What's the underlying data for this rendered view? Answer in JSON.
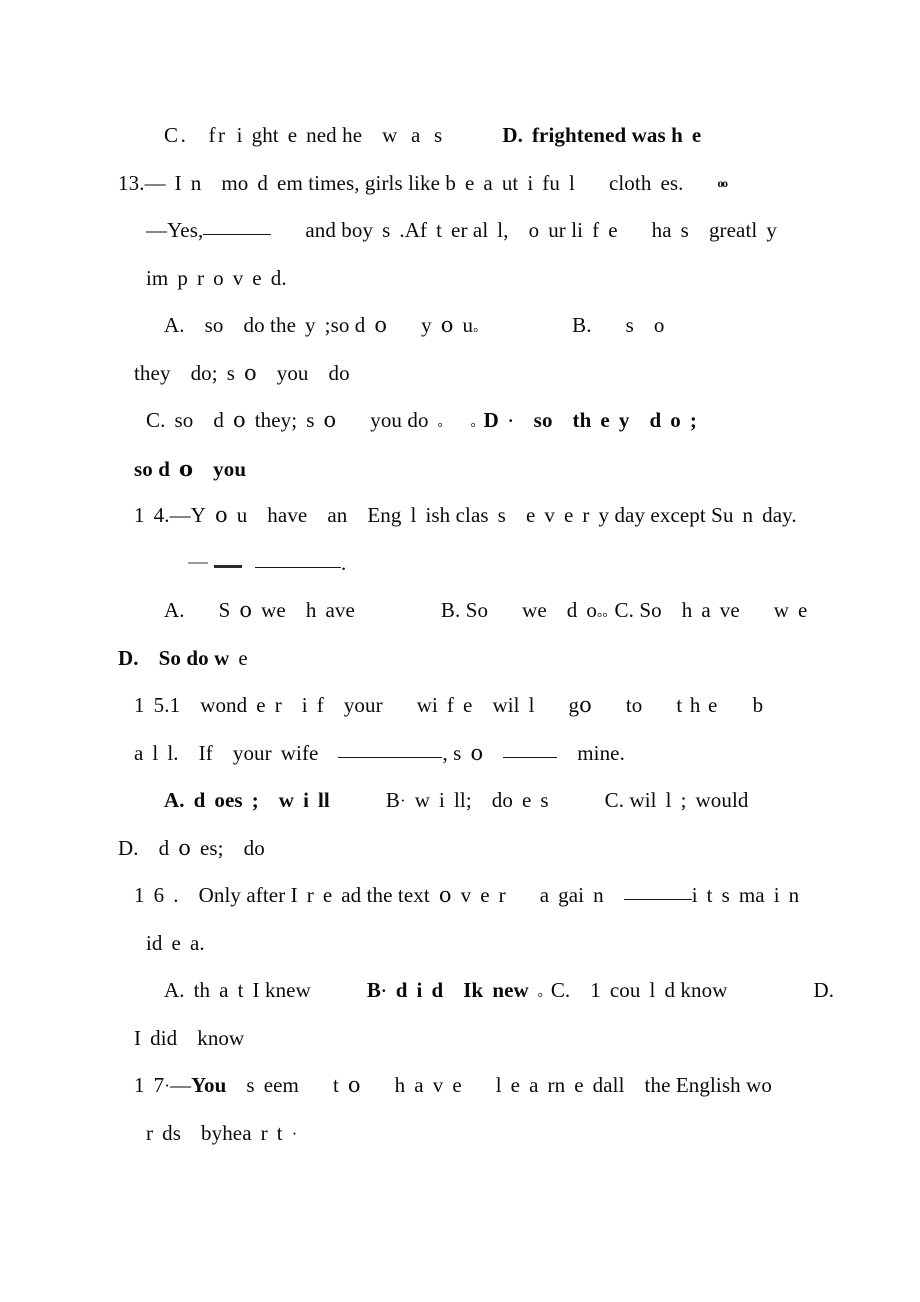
{
  "document": {
    "type": "scanned-exam-worksheet",
    "language": "English grammar multiple-choice",
    "page_background": "#ffffff",
    "text_color": "#0a0a0a"
  },
  "lines": {
    "l01_c_option": {
      "letter": "C.",
      "text_a": "fr",
      "text_b": "i",
      "text_c": "ght",
      "text_d": "e",
      "text_e": "ned he",
      "text_f": "w a s",
      "d_letter": "D",
      "d_sep": ".",
      "d_text": "frightened was h",
      "d_tail": "e"
    },
    "q13": {
      "number": "13.",
      "dash": "—",
      "t1": "I",
      "t2": "n",
      "t3": "mo",
      "t4": "d",
      "t5": "em times, girls like b",
      "t6": "e",
      "t7": "a",
      "t8": "ut",
      "t9": "i",
      "t10": "fu",
      "t11": "l",
      "t12": "cloth",
      "t13": "e",
      "t14": "s.",
      "artifact": "oo"
    },
    "q13_answer": {
      "dash": "—",
      "yes": "Yes,",
      "and_boy": "and boy",
      "s": "s",
      "period": ".",
      "after": "Af",
      "t": "t",
      "er_al": "er al",
      "l": "l",
      "comma": ",",
      "o": "o",
      "ur_li": "ur li",
      "f": "f",
      "e": "e",
      "has": "ha",
      "s2": "s",
      "greatl": "greatl",
      "y": "y"
    },
    "q13_answer2": {
      "im": "im",
      "p": "p",
      "r": "r",
      "o": "o",
      "v": "v",
      "e": "e",
      "d": "d."
    },
    "q13_opt_a": {
      "letter": "A.",
      "so": "so",
      "do_the": "do the",
      "y": "y",
      "semi": ";",
      "so_d": "so d",
      "o": "o",
      "y2": "y",
      "o2": "o",
      "u": "u",
      "dot": "。",
      "b_letter": "B.",
      "b_s": "s",
      "b_o": "o"
    },
    "q13_opt_a2": {
      "they": "they",
      "do_s": "do;",
      "s": "s",
      "o": "o",
      "you": "you",
      "do": "do"
    },
    "q13_opt_c": {
      "letter": "C.",
      "so": "so",
      "d": "d",
      "o": "o",
      "they_s": "they;",
      "s": "s",
      "you_do": "you do",
      "dot1": "。",
      "dot2": "。",
      "d_letter": "D",
      "middot": "·",
      "so2": "so",
      "th": "th",
      "e": "e",
      "y": "y",
      "d2": "d",
      "o3": "o",
      "semi": ";"
    },
    "q13_opt_c2": {
      "so_d": "so d",
      "o": "o",
      "you": "you"
    },
    "q14": {
      "n1": "1",
      "n2": "4.",
      "dash": "—",
      "y": "Y",
      "o": "o",
      "u": "u",
      "have": "have",
      "an": "an",
      "eng": "Eng",
      "l": "l",
      "ish_clas": "ish clas",
      "s": "s",
      "e": "e",
      "v": "v",
      "e2": "e",
      "r": "r",
      "y_day": "y day except Su",
      "n": "n",
      "day": "day."
    },
    "q14_answer": {
      "period": "."
    },
    "q14_opts": {
      "a_letter": "A.",
      "s": "S",
      "o": "o",
      "we": "we",
      "h": "h",
      "ave": "ave",
      "b_letter": "B. So",
      "we2": "we",
      "d": "d",
      "o2": "o",
      "dots": "。。",
      "c_letter": "C. So",
      "h2": "h",
      "a": "a",
      "ve": "ve",
      "w": "w",
      "e": "e"
    },
    "q14_opt_d": {
      "letter": "D.",
      "so_do_w": "So do w",
      "e": "e"
    },
    "q15": {
      "n1": "1",
      "n2": "5",
      "n3": ".",
      "n4": "1",
      "wond": "wond",
      "e": "e",
      "r": "r",
      "i": "i",
      "f": "f",
      "y": "y",
      "our": "our",
      "wi": "wi",
      "wil": "wil",
      "l": "l",
      "g": "g",
      "o": "o",
      "to": "to",
      "the": "t h e",
      "b": "b"
    },
    "q15b": {
      "a": "a",
      "l1": "l",
      "l2": "l.",
      "i": "I",
      "f": "f",
      "your": "your",
      "wife": "wife",
      "comma_so": ", s",
      "o": "o",
      "mine": "mine."
    },
    "q15_opts": {
      "a_letter": "A.",
      "d": "d",
      "oes": "oes",
      "semi": ";",
      "w": "w",
      "i": "i",
      "ll": "ll",
      "b_letter": "B",
      "middot": "·",
      "w2": "w",
      "i2": "i",
      "ll2": "ll;",
      "do": "do",
      "e2": "e",
      "s": "s",
      "c_letter": "C. wil",
      "l3": "l",
      "semi2": ";",
      "would": "would"
    },
    "q15_opt_d": {
      "letter": "D.",
      "d": "d",
      "o": "o",
      "es": "es;",
      "do": "do"
    },
    "q16": {
      "n1": "1",
      "n2": "6",
      "n3": ".",
      "only_after": "Only after I",
      "r": "r",
      "e": "e",
      "ad_the_text": "ad the text",
      "o": "o",
      "v": "v",
      "e2": "e",
      "a": "a",
      "gai": "gai",
      "n": "n",
      "its": "i",
      "t": "t",
      "s": "s",
      "ma": "ma",
      "i": "i"
    },
    "q16b": {
      "id": "id",
      "e": "e",
      "a": "a."
    },
    "q16_opts": {
      "a_letter": "A.",
      "th": "th",
      "a": "a",
      "t": "t",
      "i_knew": "I knew",
      "b_letter": "B",
      "middot": "·",
      "d": "d",
      "i": "i",
      "i2": "I",
      "k": "k",
      "n": "n",
      "ew": "ew",
      "dot": "。",
      "c_letter": "C.",
      "one": "1",
      "cou": "cou",
      "l": "l",
      "d_know": "d know",
      "d_letter": "D."
    },
    "q16_opt_d2": {
      "i": "I",
      "did": "did",
      "know": "know"
    },
    "q17": {
      "n1": "1",
      "n2": "7",
      "middot": "·",
      "dash": "—",
      "you": "You",
      "s": "s",
      "eem": "eem",
      "t": "t",
      "o": "o",
      "h": "h",
      "a": "a",
      "v": "v",
      "e": "e",
      "l": "l",
      "e2": "e",
      "rn": "rn",
      "e3": "e",
      "d": "d",
      "all": "all",
      "the_english": "the English wo"
    },
    "q17b": {
      "r": "r",
      "ds": "ds",
      "b": "b",
      "y": "y",
      "hea": "hea",
      "t": "t",
      "middot": "·"
    }
  }
}
